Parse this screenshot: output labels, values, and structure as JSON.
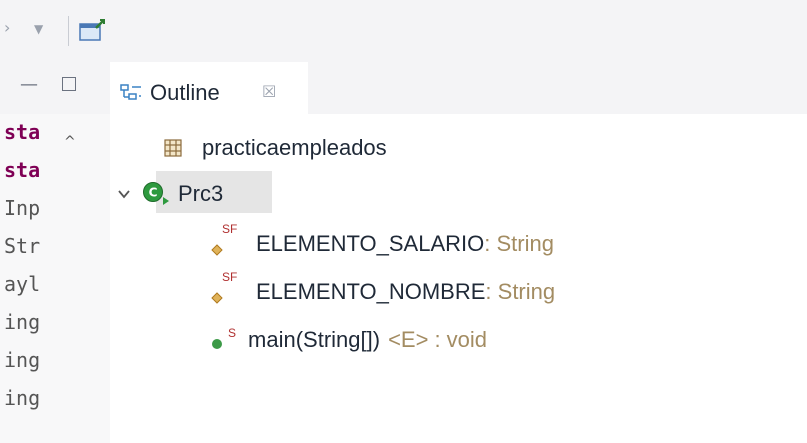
{
  "toolbar": {
    "icons": [
      "nav-forward-icon",
      "dropdown-arrow-icon",
      "new-window-icon"
    ]
  },
  "editor": {
    "icons": [
      "minimize-icon",
      "maximize-icon",
      "scroll-up-icon"
    ],
    "code_lines": [
      "sta",
      "sta",
      "Inp",
      "Str",
      "ayl",
      "ing",
      "ing",
      "ing"
    ]
  },
  "outline": {
    "tab": {
      "label": "Outline",
      "close_glyph": "☒",
      "icon": "outline-view-icon"
    },
    "package": {
      "name": "practicaempleados",
      "icon": "package-icon"
    },
    "class": {
      "name": "Prc3",
      "expanded": true,
      "icon": "class-icon"
    },
    "members": [
      {
        "modifiers": "SF",
        "name": "ELEMENTO_SALARIO",
        "type": " : String",
        "icon": "static-final-field-icon"
      },
      {
        "modifiers": "SF",
        "name": "ELEMENTO_NOMBRE",
        "type": " : String",
        "icon": "static-final-field-icon"
      },
      {
        "modifiers": "S",
        "name": "main(String[])",
        "generic": "<E>",
        "type": ": void",
        "icon": "public-method-icon"
      }
    ]
  },
  "colors": {
    "class_green": "#2e7d32",
    "method_green": "#3c9a47",
    "package_brown": "#8b6b3d",
    "type_tan": "#a38c62",
    "keyword": "#7f0055"
  }
}
